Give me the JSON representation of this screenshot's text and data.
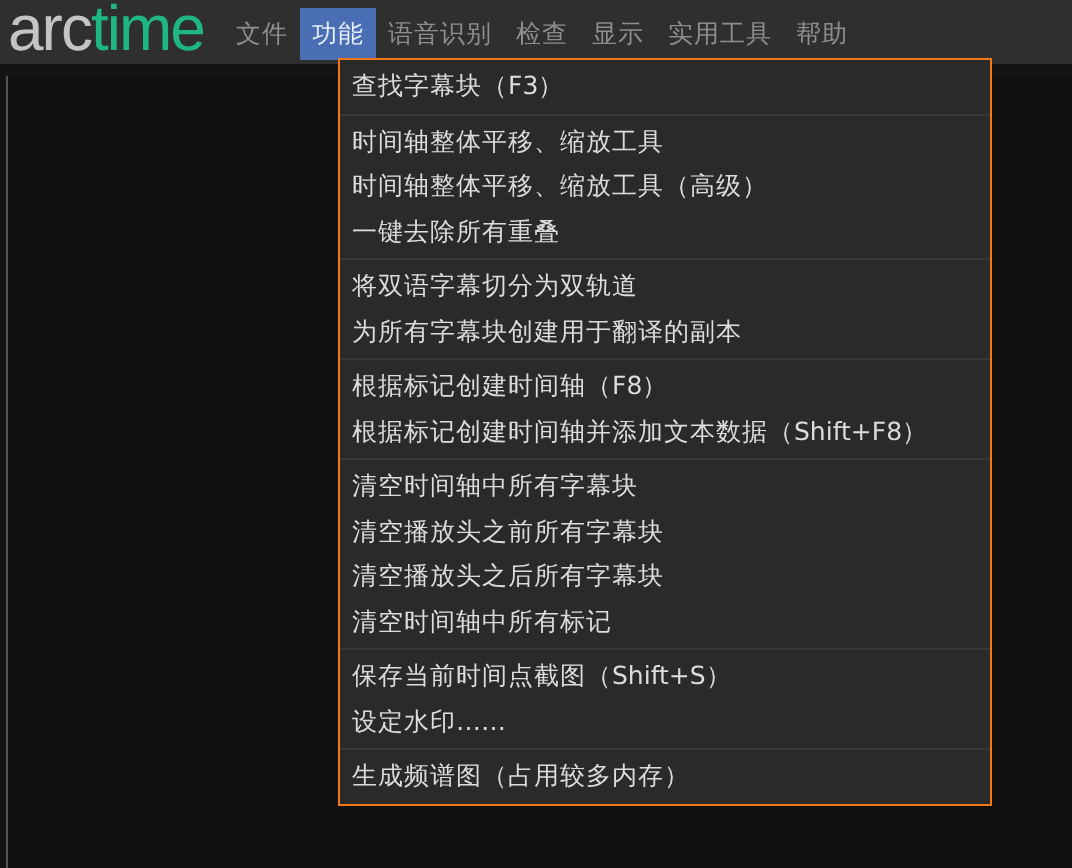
{
  "logo": [
    {
      "text": "arc",
      "color": "#c4c4c4"
    },
    {
      "text": "time",
      "color": "#1eb784"
    }
  ],
  "menubar": [
    {
      "label": "文件",
      "selected": false
    },
    {
      "label": "功能",
      "selected": true
    },
    {
      "label": "语音识别",
      "selected": false
    },
    {
      "label": "检查",
      "selected": false
    },
    {
      "label": "显示",
      "selected": false
    },
    {
      "label": "实用工具",
      "selected": false
    },
    {
      "label": "帮助",
      "selected": false
    }
  ],
  "dropdown": {
    "groups": [
      [
        "查找字幕块（F3）"
      ],
      [
        "时间轴整体平移、缩放工具",
        "时间轴整体平移、缩放工具（高级）",
        "一键去除所有重叠"
      ],
      [
        "将双语字幕切分为双轨道",
        "为所有字幕块创建用于翻译的副本"
      ],
      [
        "根据标记创建时间轴（F8）",
        "根据标记创建时间轴并添加文本数据（Shift+F8）"
      ],
      [
        "清空时间轴中所有字幕块",
        "清空播放头之前所有字幕块",
        "清空播放头之后所有字幕块",
        "清空时间轴中所有标记"
      ],
      [
        "保存当前时间点截图（Shift+S）",
        "设定水印……"
      ],
      [
        "生成频谱图（占用较多内存）"
      ]
    ]
  }
}
